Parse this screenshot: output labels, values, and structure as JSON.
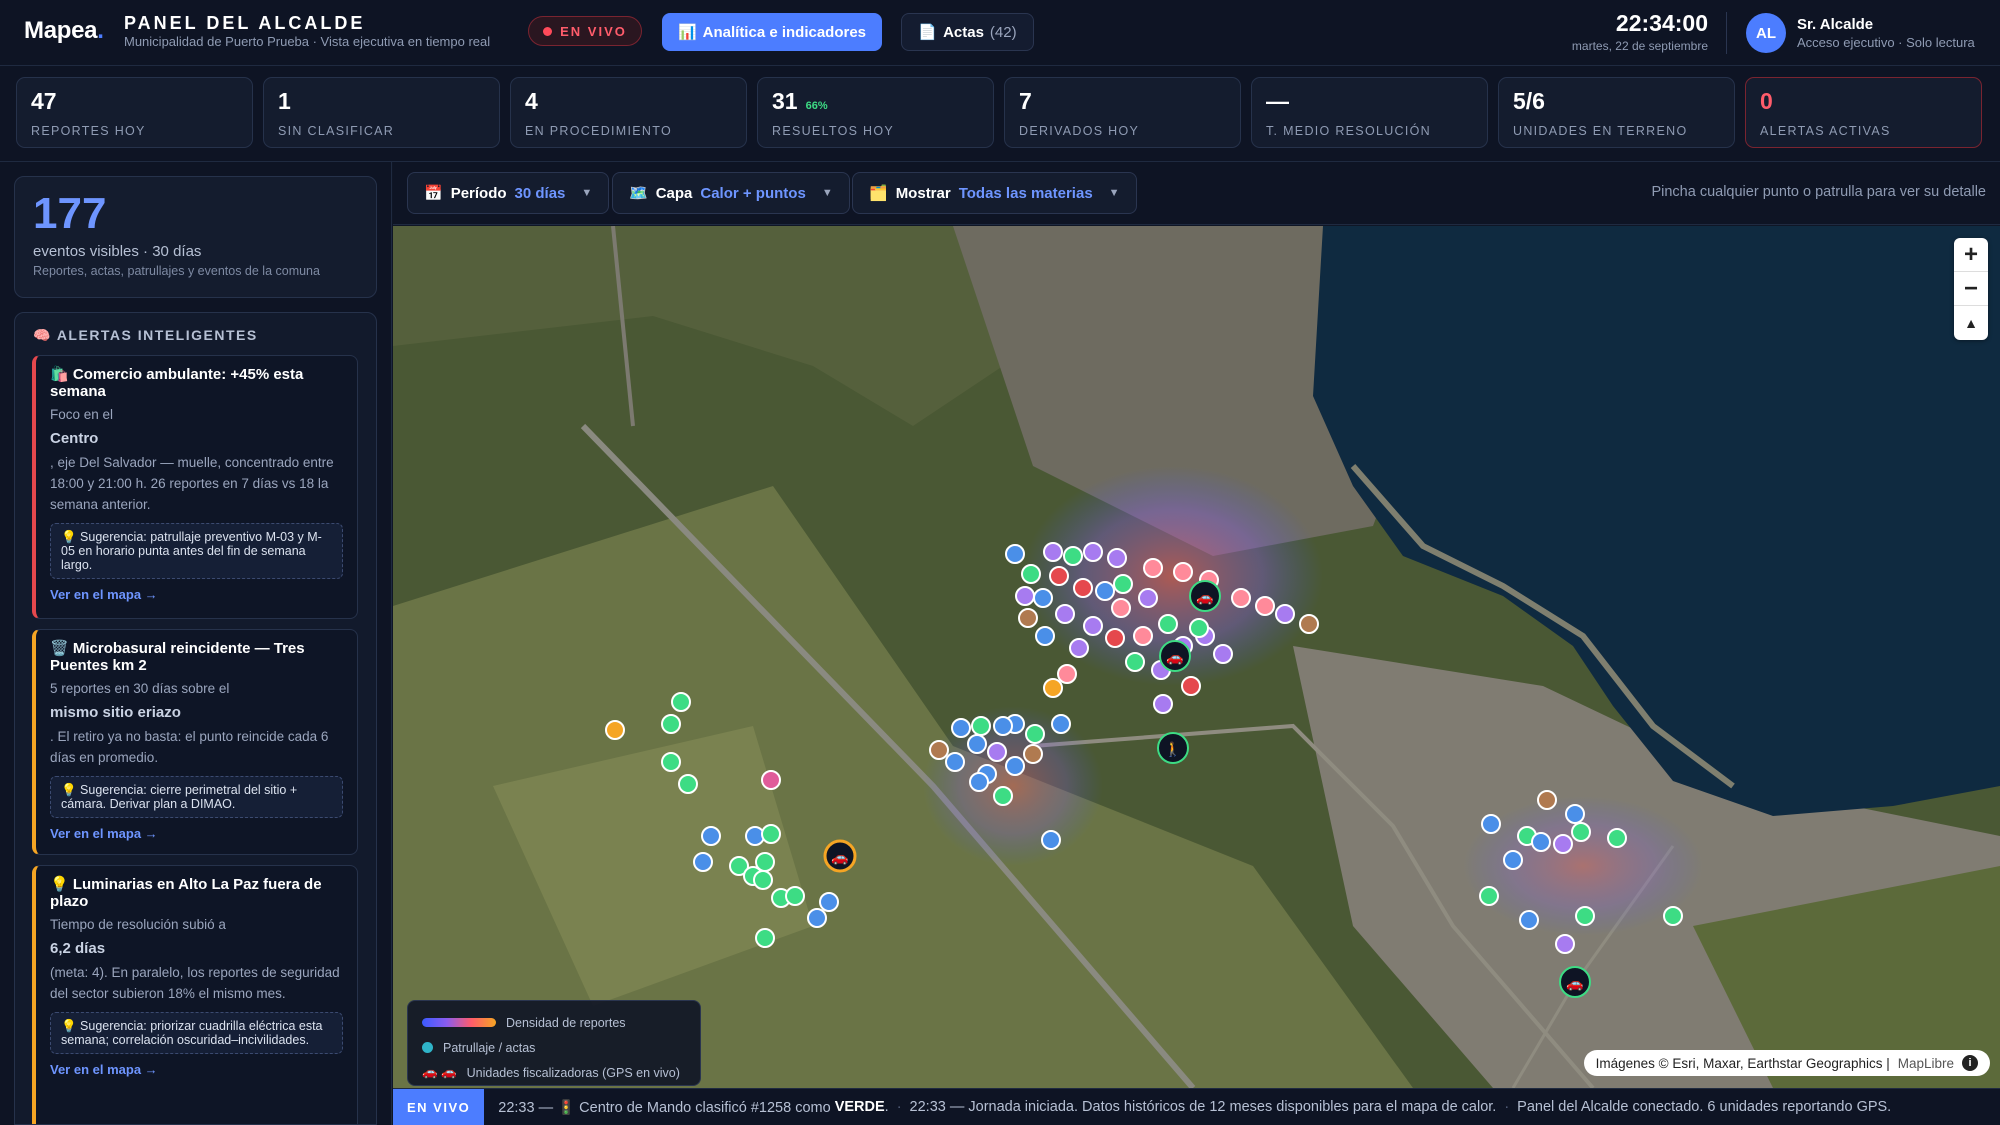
{
  "header": {
    "logo": "Mapea",
    "logo_dot": ".",
    "title": "PANEL DEL ALCALDE",
    "subtitle": "Municipalidad de Puerto Prueba · Vista ejecutiva en tiempo real",
    "live_label": "EN VIVO",
    "analytics_icon": "📊",
    "analytics_label": "Analítica e indicadores",
    "actas_icon": "📄",
    "actas_label": "Actas",
    "actas_count": "(42)",
    "time": "22:34:00",
    "date": "martes, 22 de septiembre",
    "avatar_initials": "AL",
    "user_name": "Sr. Alcalde",
    "user_role": "Acceso ejecutivo · Solo lectura"
  },
  "kpis": [
    {
      "value": "47",
      "label": "REPORTES HOY",
      "pct": ""
    },
    {
      "value": "1",
      "label": "SIN CLASIFICAR",
      "pct": ""
    },
    {
      "value": "4",
      "label": "EN PROCEDIMIENTO",
      "pct": ""
    },
    {
      "value": "31",
      "label": "RESUELTOS HOY",
      "pct": "66%"
    },
    {
      "value": "7",
      "label": "DERIVADOS HOY",
      "pct": ""
    },
    {
      "value": "—",
      "label": "T. MEDIO RESOLUCIÓN",
      "pct": ""
    },
    {
      "value": "5/6",
      "label": "UNIDADES EN TERRENO",
      "pct": ""
    },
    {
      "value": "0",
      "label": "ALERTAS ACTIVAS",
      "pct": ""
    }
  ],
  "events": {
    "count": "177",
    "label": "eventos visibles · 30 días",
    "sub": "Reportes, actas, patrullajes y eventos de la comuna"
  },
  "alerts": {
    "heading_icon": "🧠",
    "heading": "ALERTAS INTELIGENTES",
    "link_label": "Ver en el mapa →",
    "items": [
      {
        "icon": "🛍️",
        "title": "Comercio ambulante: +45% esta semana",
        "text_before": "Foco en el",
        "highlight": "Centro",
        "text_after": ", eje Del Salvador — muelle, concentrado entre 18:00 y 21:00 h. 26 reportes en 7 días vs 18 la semana anterior.",
        "suggestion": "💡 Sugerencia: patrullaje preventivo M-03 y M-05 en horario punta antes del fin de semana largo."
      },
      {
        "icon": "🗑️",
        "title": "Microbasural reincidente — Tres Puentes km 2",
        "text_before": "5 reportes en 30 días sobre el",
        "highlight": "mismo sitio eriazo",
        "text_after": ". El retiro ya no basta: el punto reincide cada 6 días en promedio.",
        "suggestion": "💡 Sugerencia: cierre perimetral del sitio + cámara. Derivar plan a DIMAO."
      },
      {
        "icon": "💡",
        "title": "Luminarias en Alto La Paz fuera de plazo",
        "text_before": "Tiempo de resolución subió a",
        "highlight": "6,2 días",
        "text_after": "(meta: 4). En paralelo, los reportes de seguridad del sector subieron 18% el mismo mes.",
        "suggestion": "💡 Sugerencia: priorizar cuadrilla eléctrica esta semana; correlación oscuridad–incivilidades."
      }
    ]
  },
  "toolbar": {
    "periodo_icon": "📅",
    "periodo_label": "Período",
    "periodo_value": "30 días",
    "capa_icon": "🗺️",
    "capa_label": "Capa",
    "capa_value": "Calor + puntos",
    "mostrar_icon": "🗂️",
    "mostrar_label": "Mostrar",
    "mostrar_value": "Todas las materias",
    "hint": "Pincha cualquier punto o patrulla para ver su detalle"
  },
  "map": {
    "zoom_in": "+",
    "zoom_out": "−",
    "compass": "▲",
    "legend_density": "Densidad de reportes",
    "legend_patrol": "Patrullaje / actas",
    "legend_units_icon": "🚗 🚗",
    "legend_units": "Unidades fiscalizadoras (GPS en vivo)",
    "attribution": "Imágenes © Esri, Maxar, Earthstar Geographics |",
    "attribution_link": "MapLibre",
    "info": "i"
  },
  "colors": {
    "accent": "#4c7dff",
    "alert_red": "#e5484d",
    "warn_amber": "#f5a524",
    "success_green": "#3ddc84"
  },
  "ticker": {
    "tag": "EN VIVO",
    "msg1_pre": "22:33 — 🚦 Centro de Mando clasificó #1258 como",
    "msg1_bold": "VERDE",
    "msg1_post": ".",
    "msg2": "22:33 — Jornada iniciada. Datos históricos de 12 meses disponibles para el mapa de calor.",
    "msg3": "Panel del Alcalde conectado. 6 unidades reportando GPS.",
    "sep": "·"
  }
}
